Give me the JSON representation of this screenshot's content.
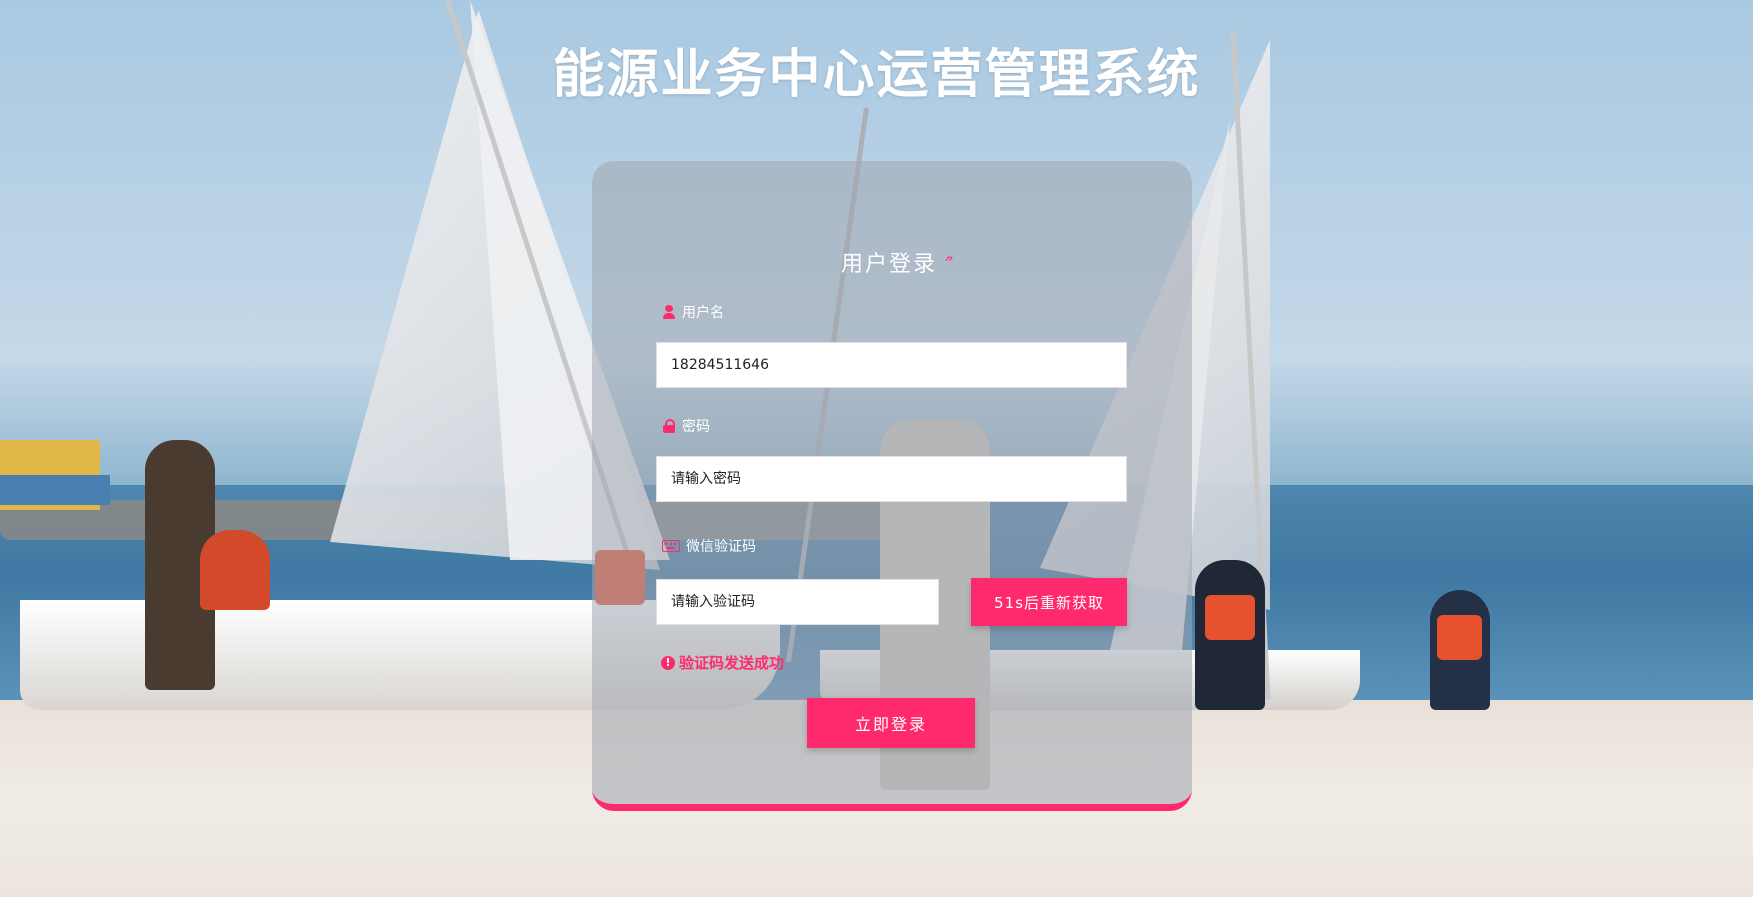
{
  "page": {
    "title": "能源业务中心运营管理系统"
  },
  "login_card": {
    "heading": "用户登录",
    "heading_mark": "ؒ",
    "username_label": "用户名",
    "username_value": "18284511646",
    "password_label": "密码",
    "password_placeholder": "请输入密码",
    "code_label": "微信验证码",
    "code_placeholder": "请输入验证码",
    "resend_button": "51s后重新获取",
    "status_message": "验证码发送成功",
    "login_button": "立即登录"
  },
  "colors": {
    "accent": "#ff2a6d",
    "card_bg": "rgba(160,166,176,0.55)",
    "text_light": "#ffffff"
  },
  "icons": {
    "username": "user-icon",
    "password": "lock-icon",
    "code": "keyboard-icon",
    "status": "alert-icon"
  }
}
